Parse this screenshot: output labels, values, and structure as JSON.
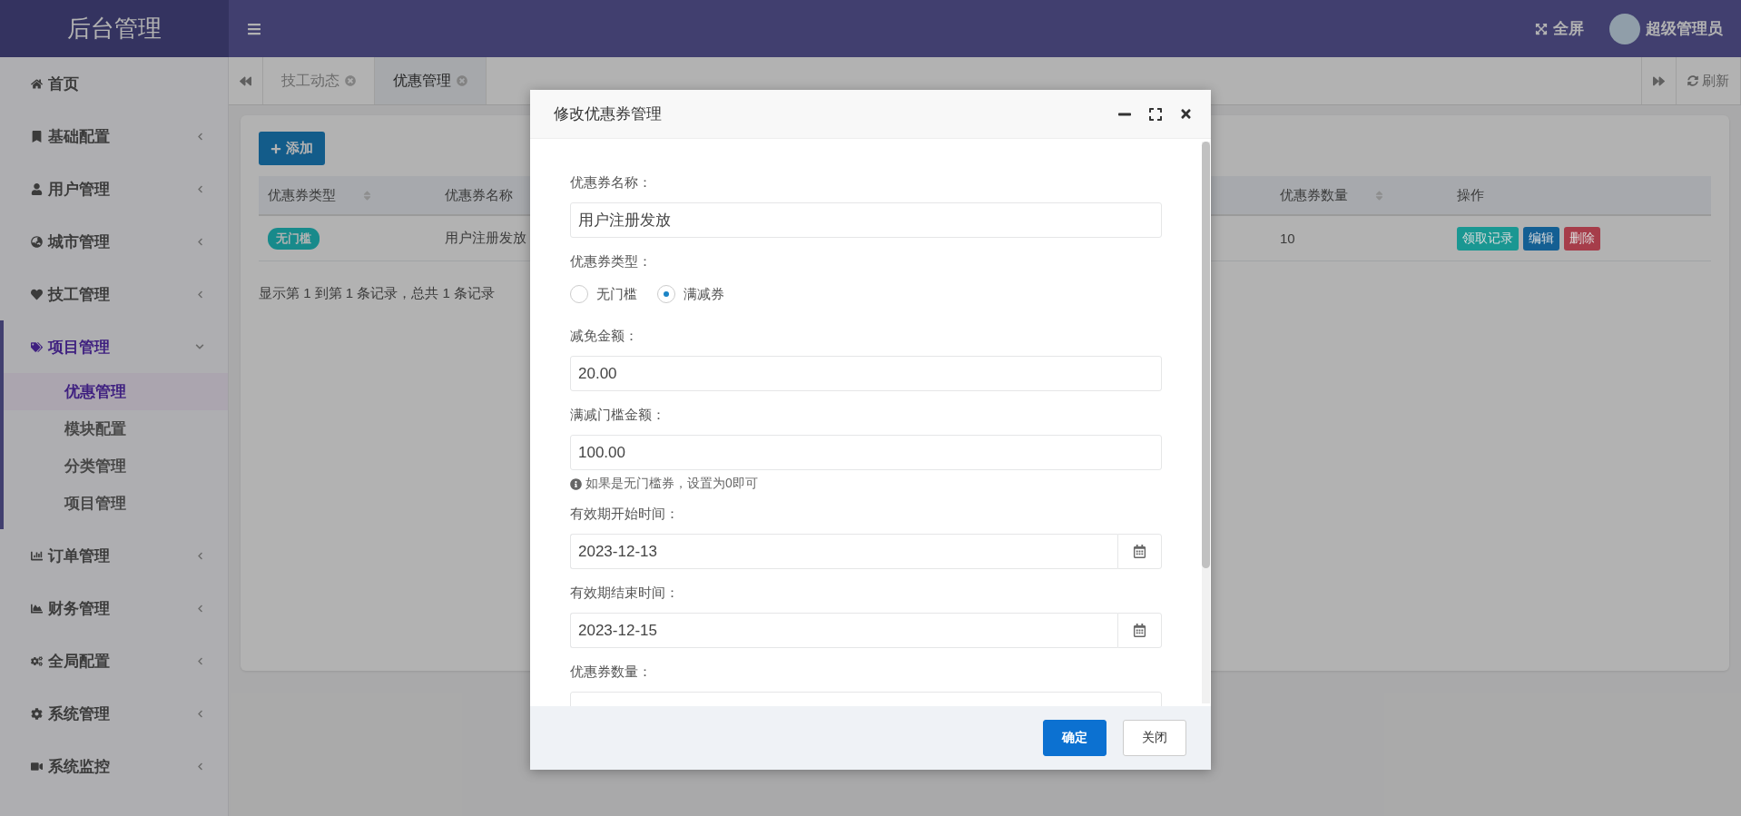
{
  "brand": "后台管理",
  "header": {
    "fullscreen": "全屏",
    "user": "超级管理员"
  },
  "sidebar": {
    "items": [
      {
        "label": "首页",
        "kind": "link"
      },
      {
        "label": "基础配置",
        "kind": "menu",
        "expanded": false
      },
      {
        "label": "用户管理",
        "kind": "menu",
        "expanded": false
      },
      {
        "label": "城市管理",
        "kind": "menu",
        "expanded": false
      },
      {
        "label": "技工管理",
        "kind": "menu",
        "expanded": false
      },
      {
        "label": "项目管理",
        "kind": "menu",
        "expanded": true,
        "children": [
          {
            "label": "优惠管理",
            "selected": true
          },
          {
            "label": "模块配置",
            "selected": false
          },
          {
            "label": "分类管理",
            "selected": false
          },
          {
            "label": "项目管理",
            "selected": false
          }
        ]
      },
      {
        "label": "订单管理",
        "kind": "menu",
        "expanded": false
      },
      {
        "label": "财务管理",
        "kind": "menu",
        "expanded": false
      },
      {
        "label": "全局配置",
        "kind": "menu",
        "expanded": false
      },
      {
        "label": "系统管理",
        "kind": "menu",
        "expanded": false
      },
      {
        "label": "系统监控",
        "kind": "menu",
        "expanded": false
      }
    ]
  },
  "tabs": [
    {
      "label": "技工动态",
      "selected": false
    },
    {
      "label": "优惠管理",
      "selected": true
    }
  ],
  "refresh": "刷新",
  "toolbar": {
    "add": "添加"
  },
  "table": {
    "columns": [
      {
        "label": "优惠券类型",
        "sortable": true
      },
      {
        "label": "优惠券名称",
        "sortable": false
      },
      {
        "label": "优惠券数量",
        "sortable": true
      },
      {
        "label": "操作",
        "sortable": false
      }
    ],
    "rows": [
      {
        "type": "无门槛",
        "name": "用户注册发放",
        "count": "10",
        "actions": [
          {
            "label": "领取记录",
            "color": "#1a9792"
          },
          {
            "label": "编辑",
            "color": "#145f93"
          },
          {
            "label": "删除",
            "color": "#a63d4a"
          }
        ]
      }
    ]
  },
  "pagination": "显示第 1 到第 1 条记录，总共 1 条记录",
  "dialog": {
    "title": "修改优惠券管理",
    "fields": [
      {
        "kind": "text",
        "label": "优惠券名称：",
        "value": "用户注册发放"
      },
      {
        "kind": "radio",
        "label": "优惠券类型：",
        "options": [
          {
            "label": "无门槛",
            "selected": false
          },
          {
            "label": "满减券",
            "selected": true
          }
        ]
      },
      {
        "kind": "text",
        "label": "减免金额：",
        "value": "20.00"
      },
      {
        "kind": "text",
        "label": "满减门槛金额：",
        "value": "100.00",
        "help": "如果是无门槛券，设置为0即可"
      },
      {
        "kind": "date",
        "label": "有效期开始时间：",
        "value": "2023-12-13"
      },
      {
        "kind": "date",
        "label": "有效期结束时间：",
        "value": "2023-12-15"
      },
      {
        "kind": "text",
        "label": "优惠券数量："
      }
    ],
    "buttons": [
      {
        "label": "确定",
        "primary": true
      },
      {
        "label": "关闭",
        "primary": false
      }
    ]
  }
}
